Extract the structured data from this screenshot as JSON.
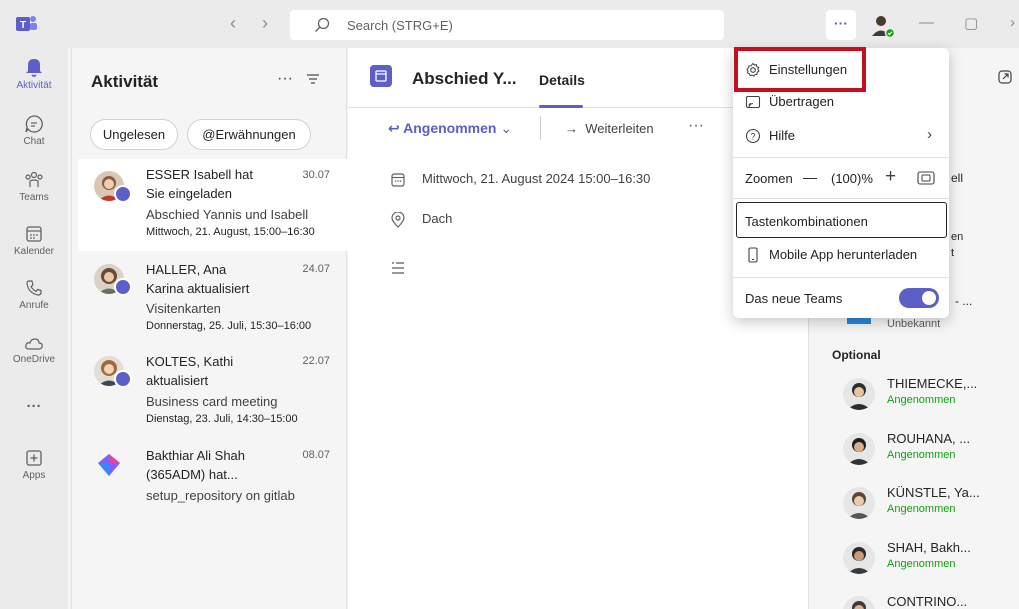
{
  "titlebar": {
    "search_placeholder": "Search (STRG+E)",
    "more_label": "···",
    "back": "‹",
    "forward": "›",
    "minimize": "—",
    "maximize": "▢",
    "close": "›"
  },
  "rail": {
    "items": [
      {
        "label": "Aktivität",
        "icon": "bell-icon",
        "active": true
      },
      {
        "label": "Chat",
        "icon": "chat-icon"
      },
      {
        "label": "Teams",
        "icon": "teams-icon"
      },
      {
        "label": "Kalender",
        "icon": "calendar-icon"
      },
      {
        "label": "Anrufe",
        "icon": "phone-icon"
      },
      {
        "label": "OneDrive",
        "icon": "cloud-icon"
      },
      {
        "label": "···",
        "icon": "more-icon"
      },
      {
        "label": "Apps",
        "icon": "apps-icon"
      }
    ]
  },
  "activity": {
    "title": "Aktivität",
    "more": "···",
    "chips": [
      "Ungelesen",
      "@Erwähnungen"
    ],
    "items": [
      {
        "line1": "ESSER Isabell hat",
        "line2": "Sie eingeladen",
        "line3": "Abschied Yannis und Isabell",
        "line4": "Mittwoch, 21. August, 15:00–16:30",
        "date": "30.07"
      },
      {
        "line1": "HALLER, Ana",
        "line2": "Karina aktualisiert",
        "line3": "Visitenkarten",
        "line4": "Donnerstag, 25. Juli, 15:30–16:00",
        "date": "24.07"
      },
      {
        "line1": "KOLTES, Kathi",
        "line2": "aktualisiert",
        "line3": "Business card meeting",
        "line4": "Dienstag, 23. Juli, 14:30–15:00",
        "date": "22.07"
      },
      {
        "line1": "Bakthiar Ali Shah",
        "line2": "(365ADM) hat...",
        "line3": "setup_repository on gitlab",
        "date": "08.07"
      }
    ]
  },
  "meeting": {
    "title": "Abschied Y...",
    "tab": "Details",
    "accepted": "Angenommen",
    "forward": "Weiterleiten",
    "more": "···",
    "datetime": "Mittwoch, 21. August 2024 15:00–16:30",
    "location": "Dach"
  },
  "participants": {
    "fragments": [
      "ell",
      "en",
      "t",
      "- ...",
      "Unbekannt"
    ],
    "optional_label": "Optional",
    "people": [
      {
        "name": "THIEMECKE,...",
        "status": "Angenommen"
      },
      {
        "name": "ROUHANA, ...",
        "status": "Angenommen"
      },
      {
        "name": "KÜNSTLE, Ya...",
        "status": "Angenommen"
      },
      {
        "name": "SHAH, Bakh...",
        "status": "Angenommen"
      },
      {
        "name": "CONTRINO...",
        "status": ""
      }
    ]
  },
  "menu": {
    "settings": "Einstellungen",
    "cast": "Übertragen",
    "help": "Hilfe",
    "zoom_label": "Zoomen",
    "zoom_minus": "—",
    "zoom_value": "(100)%",
    "zoom_plus": "+",
    "shortcuts": "Tastenkombinationen",
    "mobile": "Mobile App herunterladen",
    "new_teams": "Das neue Teams",
    "new_teams_on": true
  },
  "colors": {
    "accent": "#5b5fc7",
    "highlight": "#c50f1f",
    "accepted_green": "#13a10e"
  }
}
